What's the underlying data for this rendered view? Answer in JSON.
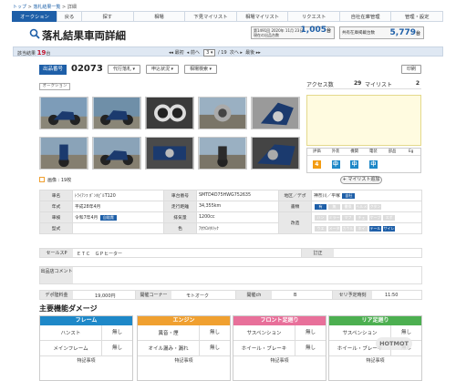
{
  "breadcrumb": {
    "home": "トップ",
    "sep1": ">",
    "list": "落札結果一覧",
    "sep2": ">",
    "current": "詳細"
  },
  "nav": [
    "オークション",
    "戻る",
    "探す",
    "相場",
    "下見マイリスト",
    "相場マイリスト",
    "リクエスト",
    "自社在庫管理",
    "管理・設定"
  ],
  "page_title": "落札結果車両詳細",
  "auction_box": {
    "line1": "第1491回 2020年 11月 23日",
    "line2": "現在の出品台数",
    "count": "1,005",
    "unit": "台"
  },
  "stock_box": {
    "label": "共有在庫掲載台数",
    "count": "5,779",
    "unit": "台"
  },
  "results_bar": {
    "label": "該当結果",
    "count": "19",
    "unit": "台",
    "first": "◂◂ 最初",
    "prev": "◂ 前へ",
    "page": "3",
    "of": "/ 19",
    "next": "次へ ▸",
    "last": "最後 ▸▸"
  },
  "lot": {
    "label": "出品番号",
    "number": "02073",
    "buttons": [
      "代行落札 ▾",
      "申込状況 ▾",
      "相場検索 ▾"
    ],
    "print": "印刷",
    "tag": "オークション"
  },
  "stats": {
    "access_label": "アクセス数",
    "access": "29",
    "mylist_label": "マイリスト",
    "mylist": "2"
  },
  "eval": {
    "headers": [
      "評価",
      "外装",
      "機関",
      "電装",
      "部品",
      "Eg"
    ],
    "values": [
      "4",
      "中",
      "中",
      "中",
      "",
      ""
    ],
    "colors": [
      "#f39c12",
      "#1e88c8",
      "#1e88c8",
      "#1e88c8"
    ]
  },
  "mylist_btn": "+ マイリスト追加",
  "image_count": "画像 : 19枚",
  "spec": {
    "rows": [
      [
        "車名",
        "ﾄﾗｲｱﾝﾌ ﾎﾞﾝﾈﾋﾞﾙT120",
        "車台番号",
        "SMTD4D75HWG752635",
        "地区／デポ",
        "神奈川／平塚"
      ],
      [
        "年式",
        "平成28年4月",
        "走行距離",
        "34,355km",
        "書類",
        ""
      ],
      [
        "車検",
        "令和7年4月",
        "排気量",
        "1200cc",
        "",
        ""
      ],
      [
        "型式",
        "",
        "色",
        "ｱｵｸﾛﾒﾀﾘｯｸ",
        "改造",
        ""
      ]
    ],
    "reg_badge": "自賠責",
    "depot_badge": "自社",
    "doc_tags": [
      "有",
      "無",
      "書換",
      "ヘルメ",
      "クタン"
    ],
    "mod_tags": [
      "ハン",
      "ミラー",
      "マフ",
      "チェ",
      "ケーブ",
      "スポ",
      "ウエ",
      "メータ",
      "カウル",
      "ホイ",
      "テール",
      "サイレ"
    ]
  },
  "sales_point": {
    "label": "セールスP",
    "text": "ＥＴＣ　ＧＰヒーター",
    "note_label": "訂正",
    "note": ""
  },
  "comment": {
    "label": "出品店コメント",
    "text": ""
  },
  "footer_info": [
    "デポ陸料金",
    "19,000円",
    "開催コーナー",
    "モトオーク",
    "開催ch",
    "B",
    "セリ予定時刻",
    "11:50"
  ],
  "damage": {
    "title": "主要機能ダメージ",
    "boxes": [
      {
        "title": "フレーム",
        "color": "#1e88c8",
        "items": [
          [
            "ハンスト",
            "無し"
          ],
          [
            "メインフレーム",
            "無し"
          ]
        ],
        "note": "特記事項"
      },
      {
        "title": "エンジン",
        "color": "#f0a030",
        "items": [
          [
            "異音・煙",
            "無し"
          ],
          [
            "オイル漏み・漏れ",
            "無し"
          ]
        ],
        "note": "特記事項"
      },
      {
        "title": "フロント足廻り",
        "color": "#e8709a",
        "items": [
          [
            "サスペンション",
            "無し"
          ],
          [
            "ホイール・ブレーキ",
            "無し"
          ]
        ],
        "note": "特記事項"
      },
      {
        "title": "リア足廻り",
        "color": "#4caf50",
        "items": [
          [
            "サスペンション",
            "無し"
          ],
          [
            "ホイール・ブレーキ",
            "無し"
          ]
        ],
        "note": "特記事項"
      }
    ]
  },
  "watermark": "HOTMOT"
}
